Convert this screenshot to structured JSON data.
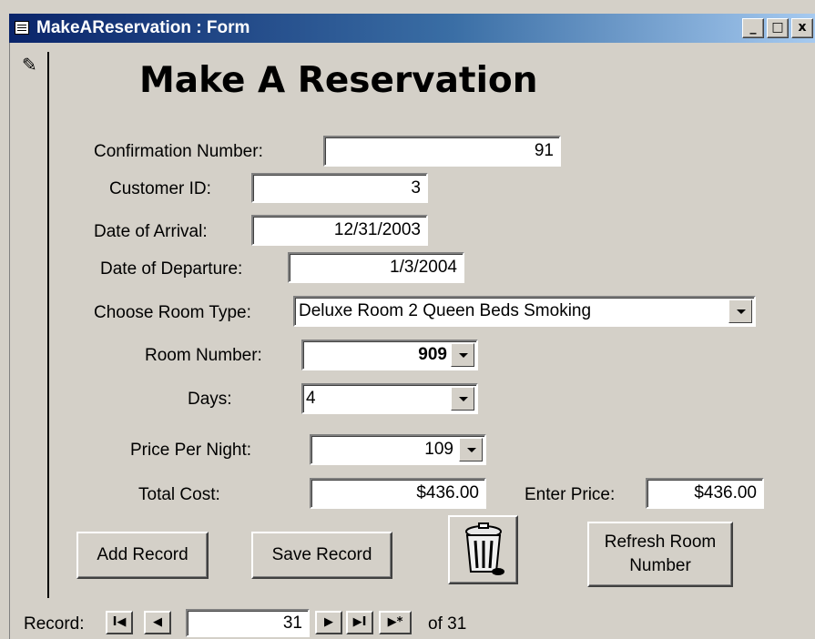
{
  "window": {
    "title": "MakeAReservation : Form",
    "minimize": "_",
    "maximize": "□",
    "close": "x"
  },
  "form": {
    "heading": "Make A Reservation",
    "confirmation_label": "Confirmation Number:",
    "confirmation_value": "91",
    "customer_label": "Customer ID:",
    "customer_value": "3",
    "arrival_label": "Date of Arrival:",
    "arrival_value": "12/31/2003",
    "departure_label": "Date of Departure:",
    "departure_value": "1/3/2004",
    "room_type_label": "Choose Room Type:",
    "room_type_value": "Deluxe Room 2 Queen Beds Smoking",
    "room_number_label": "Room Number:",
    "room_number_value": "909",
    "days_label": "Days:",
    "days_value": "4",
    "price_label": "Price Per Night:",
    "price_value": "109",
    "total_label": "Total Cost:",
    "total_value": "$436.00",
    "enter_price_label": "Enter Price:",
    "enter_price_value": "$436.00"
  },
  "buttons": {
    "add": "Add Record",
    "save": "Save Record",
    "refresh_line1": "Refresh Room",
    "refresh_line2": "Number"
  },
  "navigation": {
    "label": "Record:",
    "current": "31",
    "of_text": "of  31",
    "first": "I◀",
    "prev": "◀",
    "next": "▶",
    "last": "▶I",
    "new": "▶*"
  },
  "icons": {
    "delete": "trash-can-icon"
  }
}
